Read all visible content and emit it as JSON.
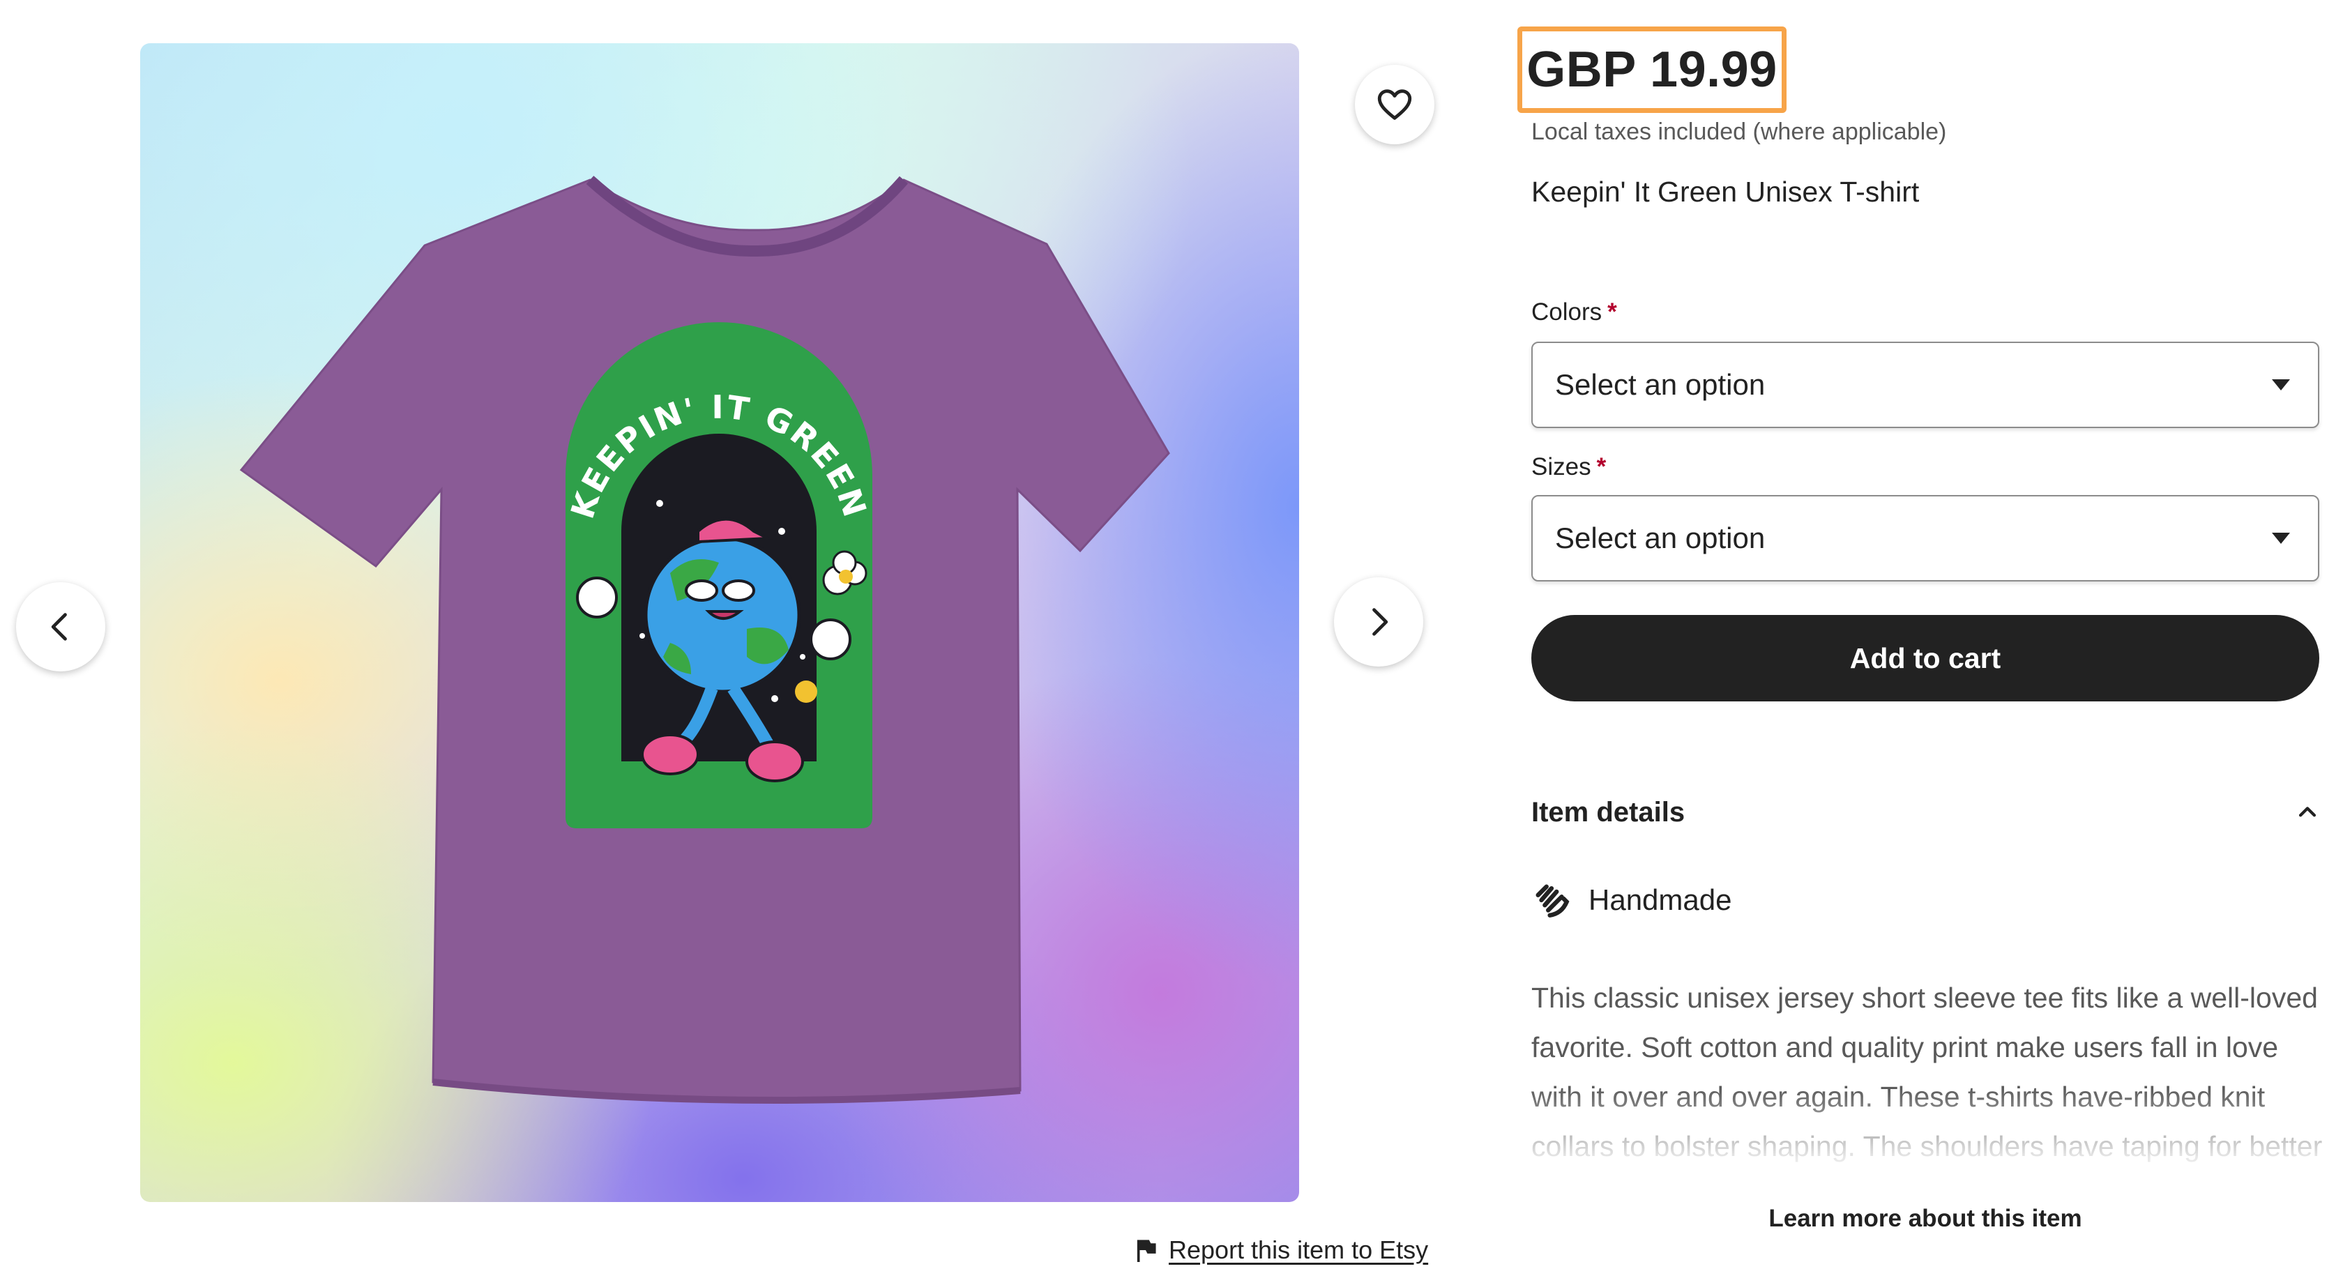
{
  "gallery": {
    "shirt_print_text": "KEEPIN' IT GREEN",
    "shirt_color": "#8a5b96",
    "arch_color": "#2fa04a",
    "prev_icon": "chevron-left-icon",
    "next_icon": "chevron-right-icon",
    "favorite_icon": "heart-icon"
  },
  "report": {
    "icon": "flag-icon",
    "label": "Report this item to Etsy"
  },
  "listing": {
    "price": "GBP 19.99",
    "price_highlight_color": "#f7a449",
    "tax_note": "Local taxes included (where applicable)",
    "title": "Keepin' It Green Unisex T-shirt"
  },
  "options": {
    "colors_label": "Colors",
    "colors_value": "Select an option",
    "sizes_label": "Sizes",
    "sizes_value": "Select an option",
    "required_mark": "*"
  },
  "cart": {
    "label": "Add to cart"
  },
  "details": {
    "header": "Item details",
    "header_icon": "chevron-up-icon",
    "handmade_icon": "hand-icon",
    "handmade_label": "Handmade",
    "description": "This classic unisex jersey short sleeve tee fits like a well-loved favorite. Soft cotton and quality print make users fall in love with it over and over again. These t-shirts have-ribbed knit collars to bolster shaping. The shoulders have taping for better fit over time. Dual side seams hold the garment's shape for longer.",
    "learn_more": "Learn more about this item"
  }
}
